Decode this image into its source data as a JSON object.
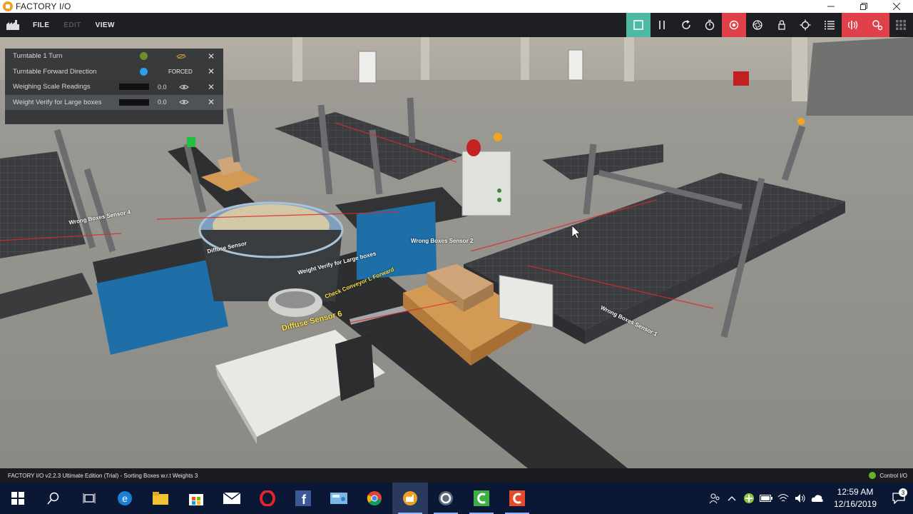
{
  "window": {
    "title": "FACTORY I/O"
  },
  "menu": {
    "file": "FILE",
    "edit": "EDIT",
    "view": "VIEW"
  },
  "toolbar": {
    "buttons": [
      "stop-icon",
      "pause-icon",
      "reset-icon",
      "timer-icon",
      "camera-target-icon",
      "aperture-icon",
      "lock-icon",
      "crosshair-icon",
      "list-icon",
      "sensor-icon",
      "driver-icon",
      "grid-icon"
    ],
    "accent_green": "#4fb8a4",
    "accent_red": "#e0404a"
  },
  "tags": [
    {
      "name": "Turntable 1 Turn",
      "type": "bool",
      "state_color": "#6f8f2a"
    },
    {
      "name": "Turntable Forward Direction",
      "type": "bool",
      "state_color": "#2aa0e8",
      "forced": "FORCED"
    },
    {
      "name": "Weighing Scale Readings",
      "type": "number",
      "value": "0.0"
    },
    {
      "name": "Weight Verify for Large boxes",
      "type": "number",
      "value": "0.0"
    }
  ],
  "scene_labels": {
    "wrong_boxes_sensor_4": "Wrong Boxes Sensor 4",
    "wrong_boxes_sensor_2": "Wrong Boxes Sensor 2",
    "wrong_boxes_sensor_1": "Wrong Boxes Sensor 1",
    "diffuse_sensor_6": "Diffuse Sensor 6",
    "check_conveyor": "Check Conveyor L Forward",
    "weight_verify": "Weight Verify for Large boxes",
    "diffuse_sensor": "Diffuse Sensor"
  },
  "status": {
    "left": "FACTORY I/O v2.2.3 Ultimate Edition (Trial) - Sorting Boxes w.r.t Weights 3",
    "right": "Control I/O"
  },
  "taskbar": {
    "apps": [
      "windows-start-icon",
      "search-icon",
      "task-view-icon",
      "edge-icon",
      "file-explorer-icon",
      "store-icon",
      "mail-icon",
      "opera-icon",
      "facebook-icon",
      "control-panel-icon",
      "chrome-icon",
      "factory-io-icon",
      "cortana-c-icon",
      "green-c-icon",
      "red-c-icon"
    ],
    "time": "12:59 AM",
    "date": "12/16/2019",
    "notifications": "3"
  }
}
